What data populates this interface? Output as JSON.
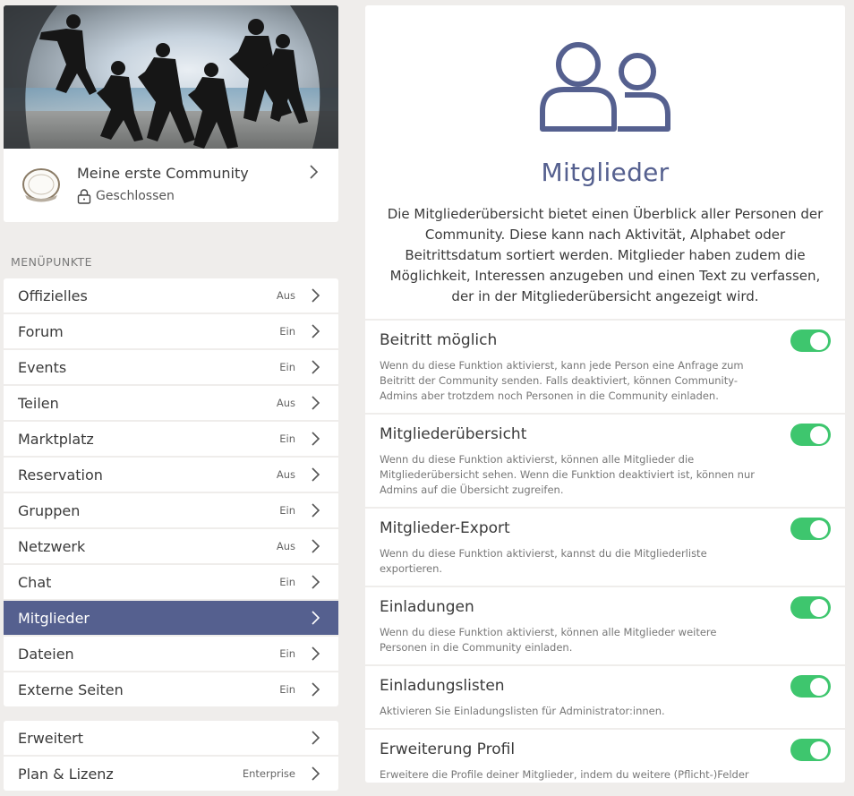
{
  "community": {
    "name": "Meine erste Community",
    "status": "Geschlossen"
  },
  "menu": {
    "section_label": "MENÜPUNKTE",
    "items": [
      {
        "label": "Offizielles",
        "state": "Aus"
      },
      {
        "label": "Forum",
        "state": "Ein"
      },
      {
        "label": "Events",
        "state": "Ein"
      },
      {
        "label": "Teilen",
        "state": "Aus"
      },
      {
        "label": "Marktplatz",
        "state": "Ein"
      },
      {
        "label": "Reservation",
        "state": "Aus"
      },
      {
        "label": "Gruppen",
        "state": "Ein"
      },
      {
        "label": "Netzwerk",
        "state": "Aus"
      },
      {
        "label": "Chat",
        "state": "Ein"
      },
      {
        "label": "Mitglieder",
        "state": ""
      },
      {
        "label": "Dateien",
        "state": "Ein"
      },
      {
        "label": "Externe Seiten",
        "state": "Ein"
      }
    ],
    "extra": [
      {
        "label": "Erweitert",
        "state": ""
      },
      {
        "label": "Plan & Lizenz",
        "state": "Enterprise"
      }
    ]
  },
  "panel": {
    "icon": "users-icon",
    "title": "Mitglieder",
    "description": "Die Mitgliederübersicht bietet einen Überblick aller Personen der Community. Diese kann nach Aktivität, Alphabet oder Beitrittsdatum sortiert werden. Mitglieder haben zudem die Möglichkeit, Interessen anzugeben und einen Text zu verfassen, der in der Mitgliederübersicht angezeigt wird."
  },
  "settings": [
    {
      "title": "Beitritt möglich",
      "desc": "Wenn du diese Funktion aktivierst, kann jede Person eine Anfrage zum Beitritt der Community senden. Falls deaktiviert, können Community-Admins aber trotzdem noch Personen in die Community einladen.",
      "enabled": true
    },
    {
      "title": "Mitgliederübersicht",
      "desc": "Wenn du diese Funktion aktivierst, können alle Mitglieder die Mitgliederübersicht sehen. Wenn die Funktion deaktiviert ist, können nur Admins auf die Übersicht zugreifen.",
      "enabled": true
    },
    {
      "title": "Mitglieder-Export",
      "desc": "Wenn du diese Funktion aktivierst, kannst du die Mitgliederliste exportieren.",
      "enabled": true
    },
    {
      "title": "Einladungen",
      "desc": "Wenn du diese Funktion aktivierst, können alle Mitglieder weitere Personen in die Community einladen.",
      "enabled": true
    },
    {
      "title": "Einladungslisten",
      "desc": "Aktivieren Sie Einladungslisten für Administrator:innen.",
      "enabled": true
    },
    {
      "title": "Erweiterung Profil",
      "desc": "Erweitere die Profile deiner Mitglieder, indem du weitere (Pflicht-)Felder hinzufügst.",
      "enabled": true
    }
  ],
  "colors": {
    "accent": "#55608f",
    "toggle_on": "#3ec66e",
    "background": "#efedeb"
  }
}
